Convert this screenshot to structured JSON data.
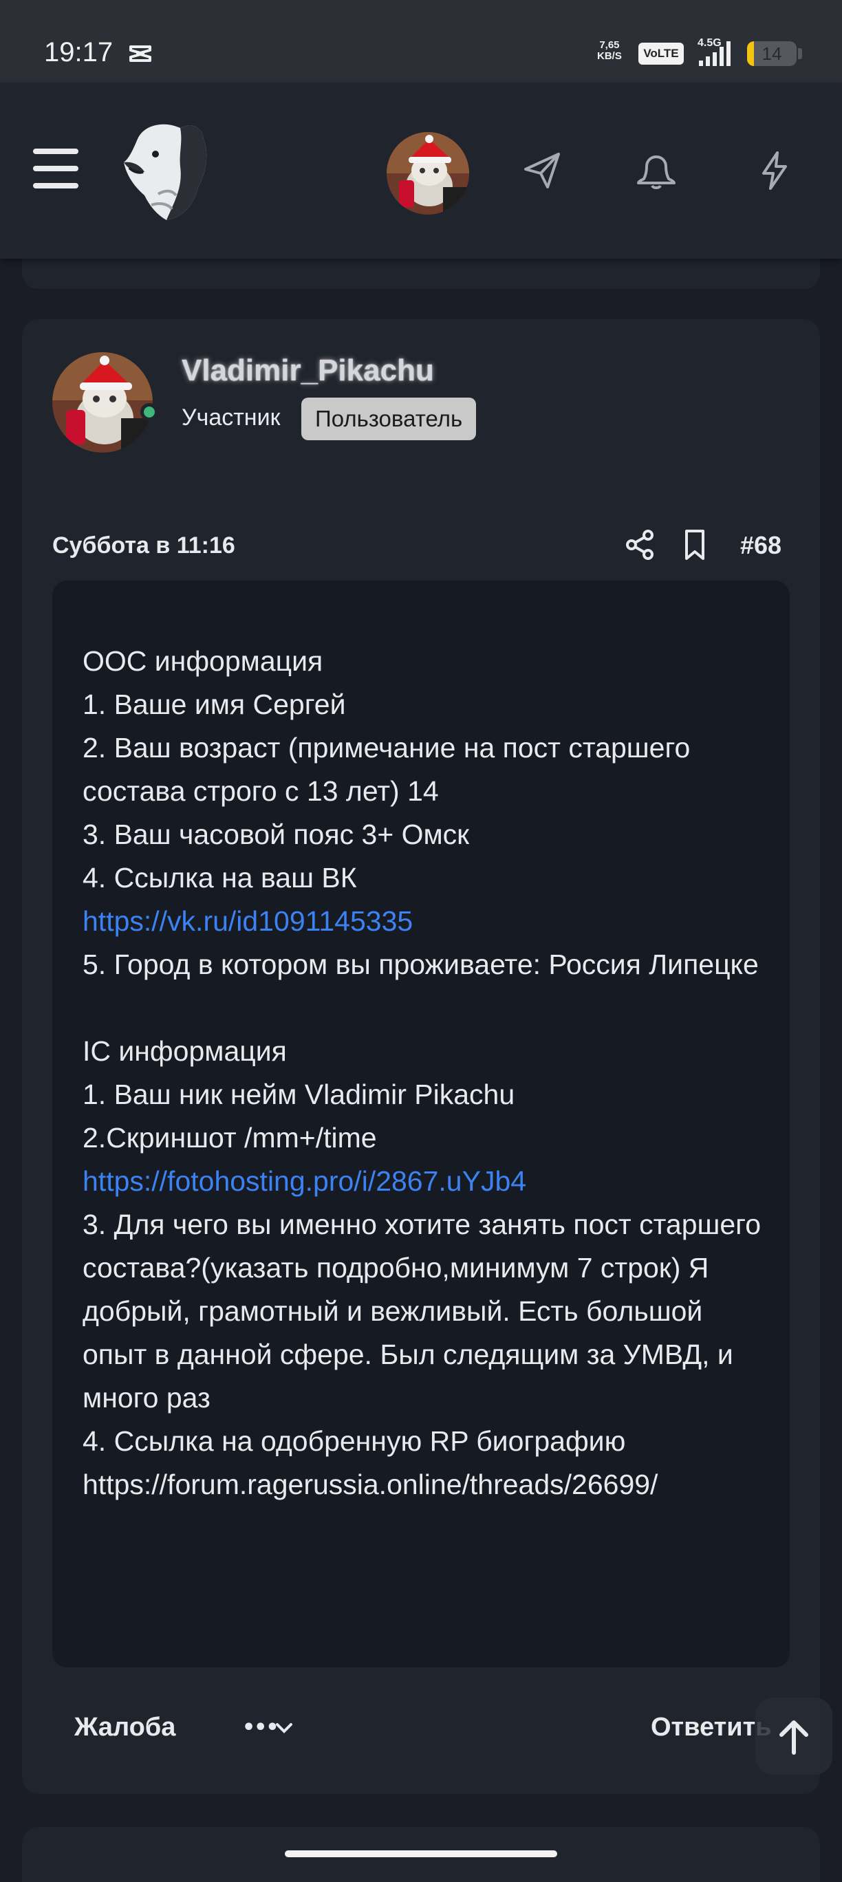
{
  "status_bar": {
    "time": "19:17",
    "net_speed_value": "7,65",
    "net_speed_unit": "KB/S",
    "volte_label": "VoLTE",
    "network_label": "4.5G",
    "battery_level": "14",
    "battery_fraction": 0.14,
    "battery_color": "#f2c511"
  },
  "header": {
    "menu_icon": "hamburger-menu-icon",
    "logo_icon": "bear-logo-icon",
    "avatar_icon": "user-avatar",
    "icons": [
      "paper-plane-icon",
      "bell-icon",
      "lightning-icon"
    ]
  },
  "post": {
    "author_name": "Vladimir_Pikachu",
    "author_role": "Участник",
    "author_badge": "Пользователь",
    "online_color": "#3fb67a",
    "date": "Суббота в 11:16",
    "number": "#68",
    "lines": [
      {
        "text": "ООС информация"
      },
      {
        "text": "1. Ваше имя Сергей"
      },
      {
        "text": "2. Ваш возраст (примечание на пост старшего состава строго с 13 лет) 14"
      },
      {
        "text": "3. Ваш часовой пояс 3+ Омск"
      },
      {
        "text": "4. Ссылка на ваш ВК"
      },
      {
        "text": "https://vk.ru/id1091145335",
        "link": true
      },
      {
        "text": "5. Город в котором вы проживаете: Россия Липецке"
      },
      {
        "text": "",
        "blank": true
      },
      {
        "text": "IC информация"
      },
      {
        "text": "1. Ваш ник нейм Vladimir Pikachu"
      },
      {
        "text": "2.Скриншот /mm+/time"
      },
      {
        "text": "https://fotohosting.pro/i/2867.uYJb4",
        "link": true
      },
      {
        "text": "3. Для чего вы именно хотите занять пост старшего состава?(указать подробно,минимум 7 строк) Я добрый, грамотный и вежливый. Есть большой опыт в данной сфере. Был следящим за УМВД, и много раз"
      },
      {
        "text": "4. Ссылка на одобренную RP биографию"
      },
      {
        "text": "https://forum.ragerussia.online/threads/26699/"
      }
    ],
    "link_color": "#3d82f2",
    "report_label": "Жалоба",
    "more_label": "•••",
    "reply_label": "Ответить"
  }
}
